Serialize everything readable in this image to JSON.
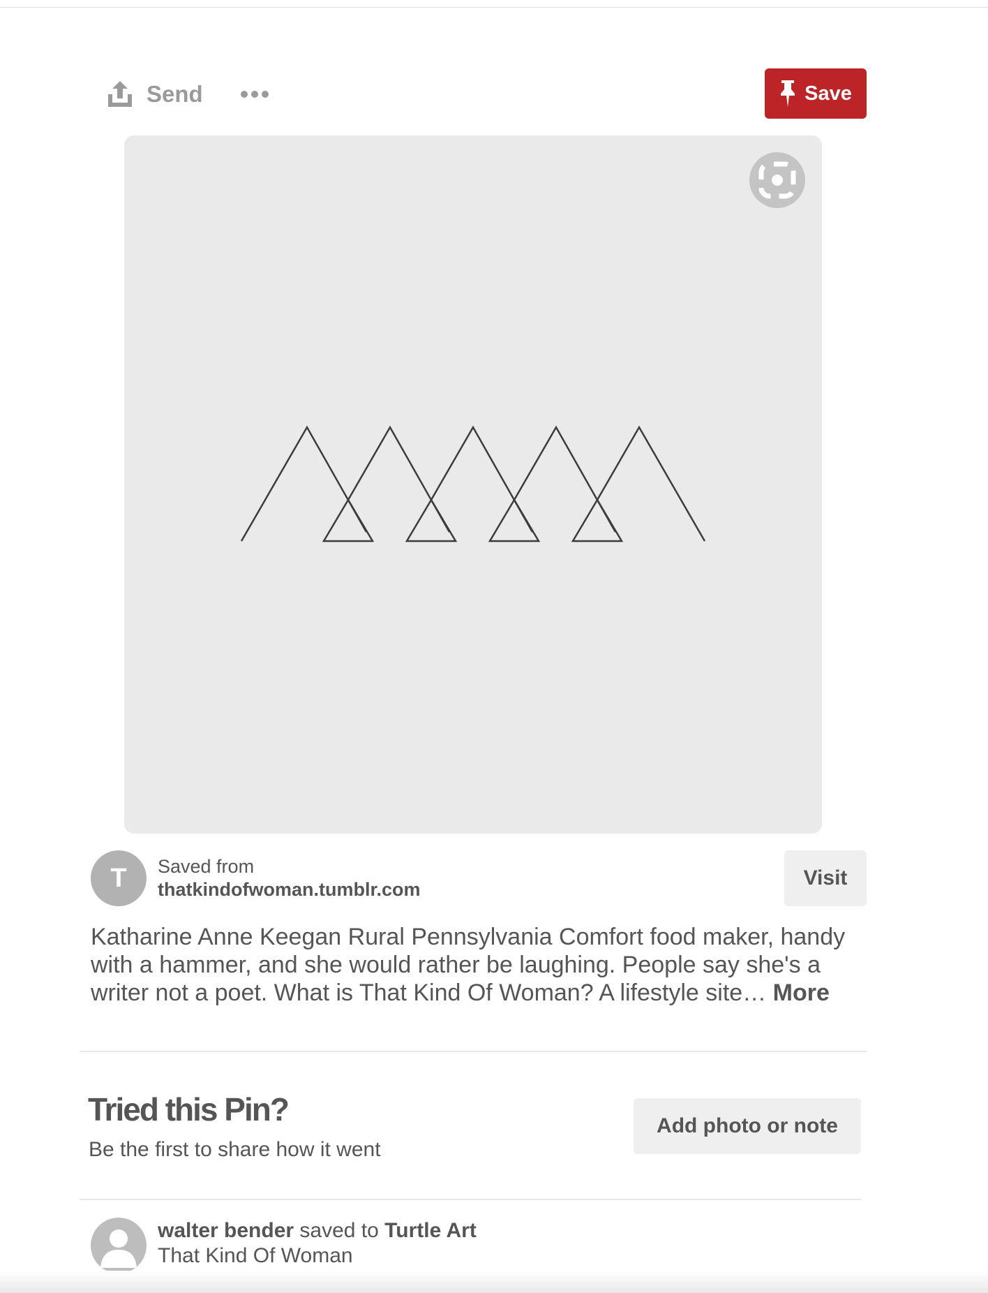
{
  "toolbar": {
    "send_label": "Send",
    "save_label": "Save",
    "accent_color": "#bd2428"
  },
  "pin": {
    "source": {
      "avatar_letter": "T",
      "saved_from_label": "Saved from",
      "domain": "thatkindofwoman.tumblr.com",
      "visit_label": "Visit"
    },
    "description": "Katharine Anne Keegan Rural Pennsylvania Comfort food maker, handy with a hammer, and she would rather be laughing. People say she's a writer not a poet. What is That Kind Of Woman? A lifestyle site…",
    "more_label": "More"
  },
  "tried": {
    "title": "Tried this Pin?",
    "subtitle": "Be the first to share how it went",
    "button_label": "Add photo or note"
  },
  "activity": {
    "user": "walter bender",
    "action": "saved to",
    "board": "Turtle Art",
    "pin_title": "That Kind Of Woman"
  }
}
